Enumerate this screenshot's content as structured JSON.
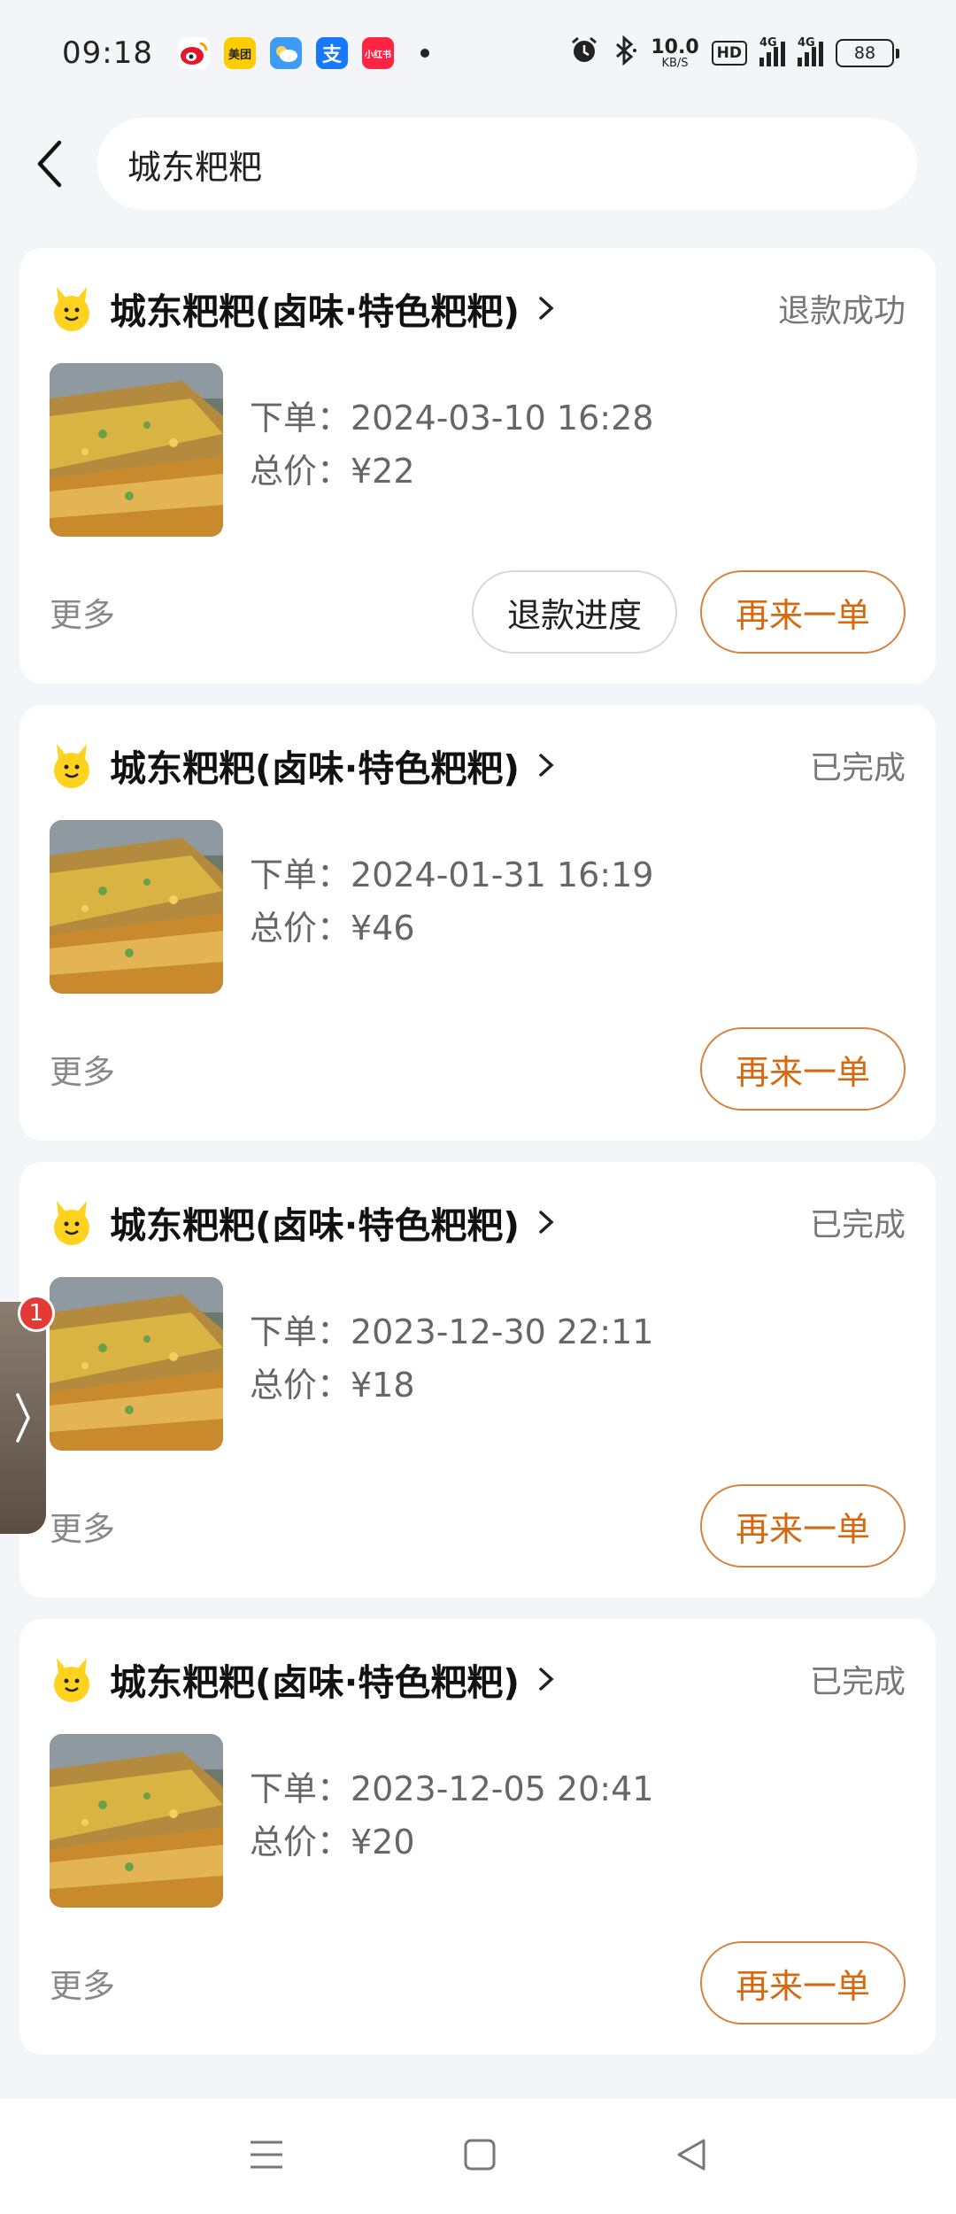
{
  "status_bar": {
    "time": "09:18",
    "apps": [
      {
        "icon": "weibo-icon",
        "color": "#f7c531",
        "text": ""
      },
      {
        "icon": "meituan-icon",
        "color": "#ffcc00",
        "text": "美团"
      },
      {
        "icon": "weather-icon",
        "color": "#3d9cf5",
        "text": ""
      },
      {
        "icon": "alipay-icon",
        "color": "#1677ff",
        "text": "支"
      },
      {
        "icon": "xiaohongshu-icon",
        "color": "#ff2442",
        "text": "小红书"
      }
    ],
    "net_speed_value": "10.0",
    "net_speed_unit": "KB/S",
    "hd_label": "HD",
    "signal_label_1": "4G",
    "signal_label_2": "4G",
    "battery": "88"
  },
  "search": {
    "value": "城东粑粑"
  },
  "orders": [
    {
      "shop_name": "城东粑粑(卤味·特色粑粑)",
      "status": "退款成功",
      "order_time_label": "下单：2024-03-10 16:28",
      "total_label": "总价：¥22",
      "more": "更多",
      "secondary_button": "退款进度",
      "primary_button": "再来一单"
    },
    {
      "shop_name": "城东粑粑(卤味·特色粑粑)",
      "status": "已完成",
      "order_time_label": "下单：2024-01-31 16:19",
      "total_label": "总价：¥46",
      "more": "更多",
      "primary_button": "再来一单"
    },
    {
      "shop_name": "城东粑粑(卤味·特色粑粑)",
      "status": "已完成",
      "order_time_label": "下单：2023-12-30 22:11",
      "total_label": "总价：¥18",
      "more": "更多",
      "primary_button": "再来一单"
    },
    {
      "shop_name": "城东粑粑(卤味·特色粑粑)",
      "status": "已完成",
      "order_time_label": "下单：2023-12-05 20:41",
      "total_label": "总价：¥20",
      "more": "更多",
      "primary_button": "再来一单"
    }
  ],
  "floating_tab": {
    "badge_count": "1"
  },
  "colors": {
    "accent": "#d6690f",
    "background": "#f4f5f9"
  }
}
